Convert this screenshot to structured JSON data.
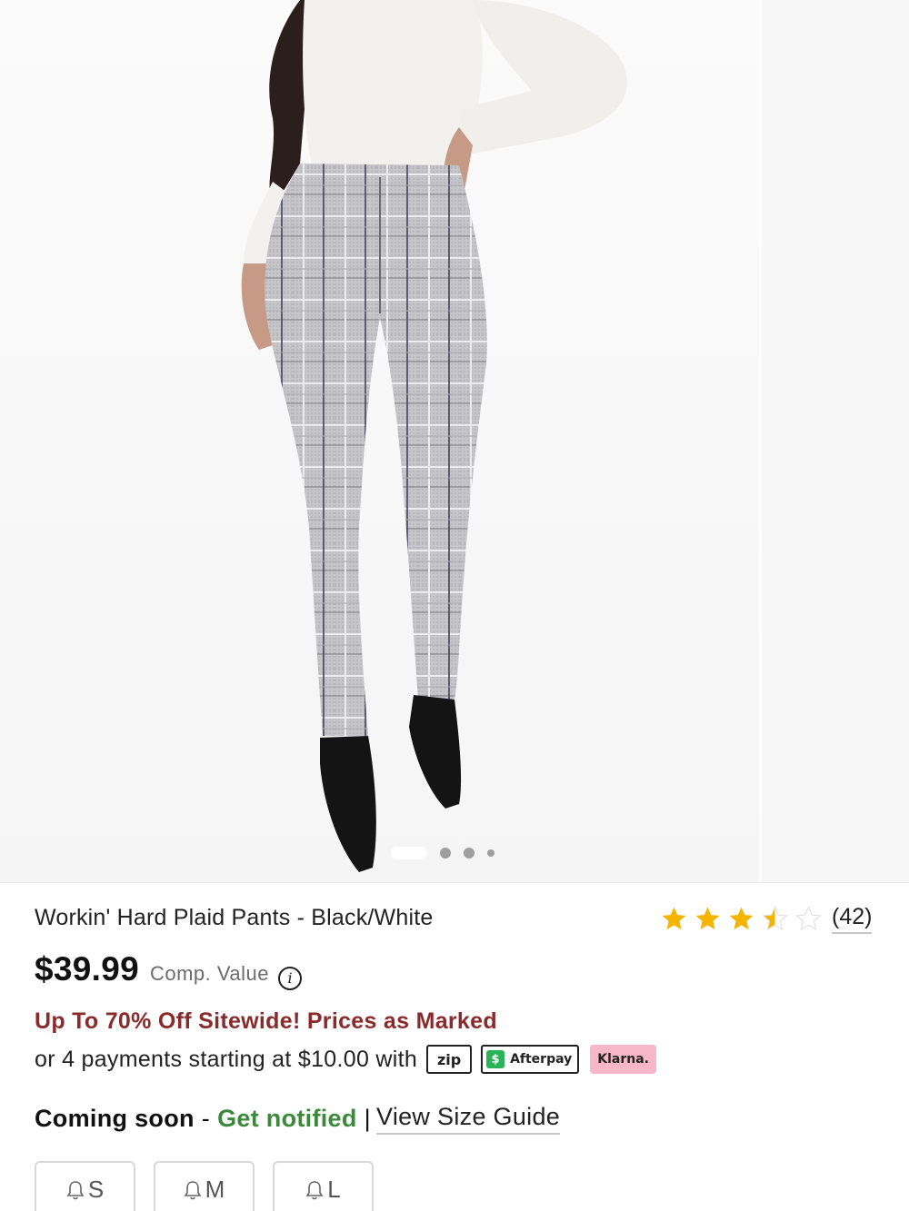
{
  "gallery": {
    "total_images": 4,
    "active_index": 0
  },
  "product": {
    "title": "Workin' Hard Plaid Pants - Black/White",
    "rating": 3.5,
    "rating_max": 5,
    "review_count": "(42)",
    "price": "$39.99",
    "comp_value_label": "Comp. Value",
    "info_icon_glyph": "i"
  },
  "promo": {
    "text": "Up To 70% Off Sitewide! Prices as Marked"
  },
  "payments": {
    "text": "or 4 payments starting at $10.00 with",
    "zip_label": "zip",
    "afterpay_label": "Afterpay",
    "afterpay_mark": "$",
    "klarna_label": "Klarna."
  },
  "availability": {
    "status": "Coming soon",
    "separator": "-",
    "notify_label": "Get notified",
    "pipe": "|",
    "size_guide_label": "View Size Guide"
  },
  "sizes": [
    {
      "label": "S"
    },
    {
      "label": "M"
    },
    {
      "label": "L"
    }
  ],
  "colors": {
    "promo": "#8a2a2a",
    "notify": "#3a8a3a",
    "star": "#f5b400",
    "klarna": "#f8b7c8",
    "afterpay": "#2bb35a"
  },
  "icons": [
    "star-icon",
    "info-icon",
    "bell-icon",
    "zip-logo",
    "afterpay-logo",
    "klarna-logo"
  ]
}
